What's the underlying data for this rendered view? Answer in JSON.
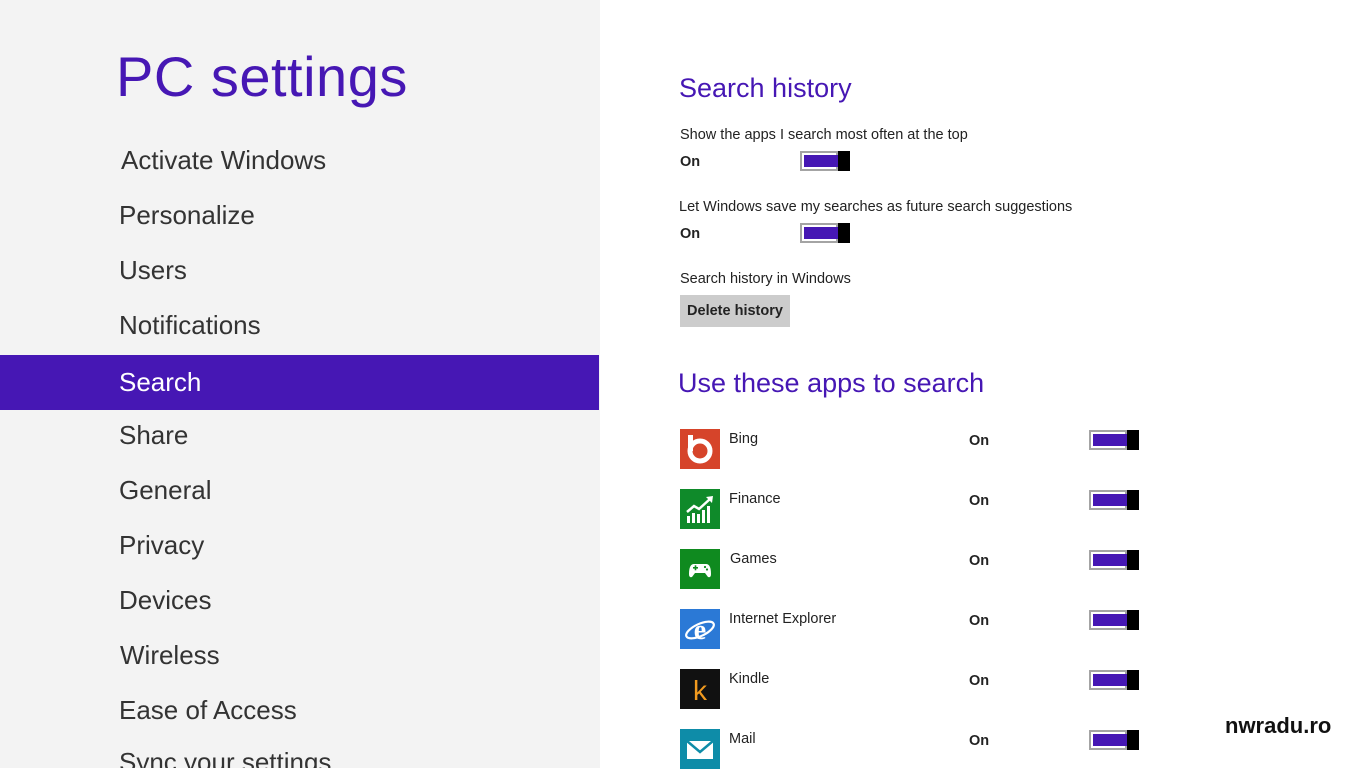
{
  "sidebar": {
    "title": "PC settings",
    "items": [
      {
        "label": "Activate Windows"
      },
      {
        "label": "Personalize"
      },
      {
        "label": "Users"
      },
      {
        "label": "Notifications"
      },
      {
        "label": "Search"
      },
      {
        "label": "Share"
      },
      {
        "label": "General"
      },
      {
        "label": "Privacy"
      },
      {
        "label": "Devices"
      },
      {
        "label": "Wireless"
      },
      {
        "label": "Ease of Access"
      },
      {
        "label": "Sync your settings"
      }
    ],
    "selected": "Search"
  },
  "search_history": {
    "title": "Search history",
    "show_apps_top": {
      "label": "Show the apps I search most often at the top",
      "state": "On",
      "on": true
    },
    "save_searches": {
      "label": "Let Windows save my searches as future search suggestions",
      "state": "On",
      "on": true
    },
    "history_label": "Search history in Windows",
    "delete_button": "Delete history"
  },
  "search_apps": {
    "title": "Use these apps to search",
    "apps": [
      {
        "name": "Bing",
        "state": "On",
        "on": true,
        "icon": "bing-icon",
        "color": "#d6442a"
      },
      {
        "name": "Finance",
        "state": "On",
        "on": true,
        "icon": "finance-icon",
        "color": "#0f8a2a"
      },
      {
        "name": "Games",
        "state": "On",
        "on": true,
        "icon": "games-icon",
        "color": "#0f8a1f"
      },
      {
        "name": "Internet Explorer",
        "state": "On",
        "on": true,
        "icon": "internet-explorer-icon",
        "color": "#2b79d6"
      },
      {
        "name": "Kindle",
        "state": "On",
        "on": true,
        "icon": "kindle-icon",
        "color": "#111111"
      },
      {
        "name": "Mail",
        "state": "On",
        "on": true,
        "icon": "mail-icon",
        "color": "#0e8ca8"
      }
    ]
  },
  "colors": {
    "accent": "#4617b4",
    "sidebar_bg": "#f3f3f3",
    "button_bg": "#cccccc"
  },
  "watermark": "nwradu.ro"
}
